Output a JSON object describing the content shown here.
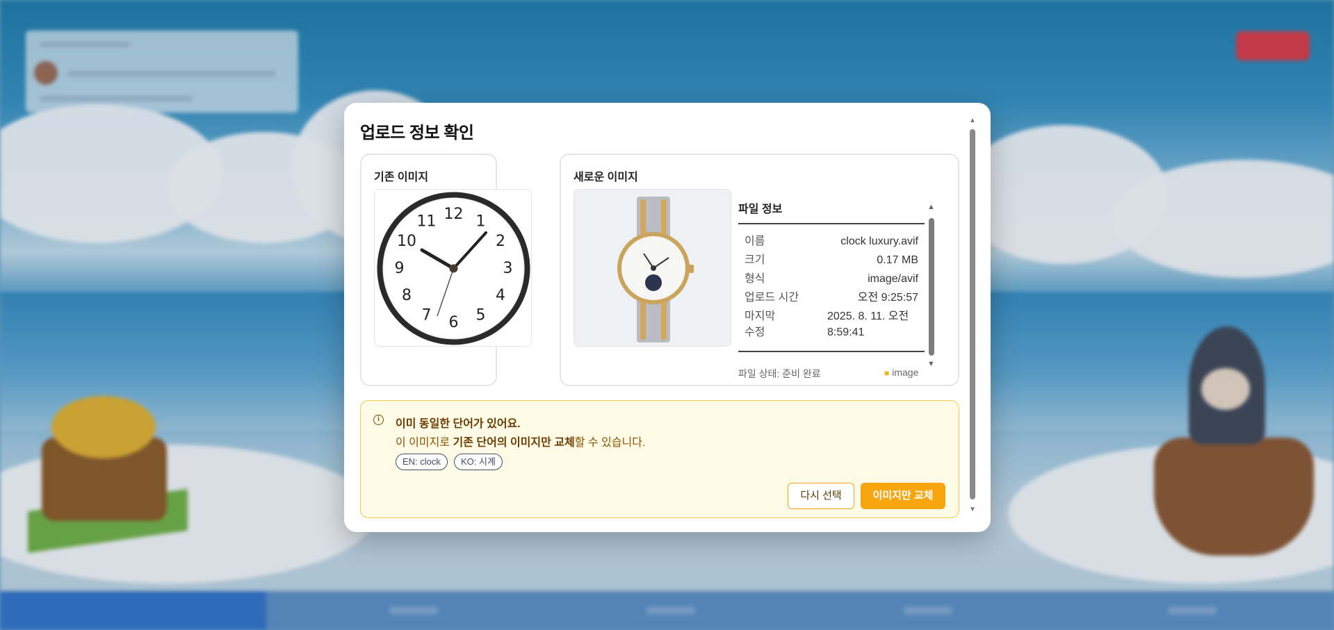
{
  "modal": {
    "title": "업로드 정보 확인",
    "old_image": {
      "title": "기존 이미지",
      "numbers": [
        "12",
        "1",
        "2",
        "3",
        "4",
        "5",
        "6",
        "7",
        "8",
        "9",
        "10",
        "11"
      ]
    },
    "new_image": {
      "title": "새로운 이미지"
    },
    "file_info": {
      "title": "파일 정보",
      "rows": [
        {
          "key": "이름",
          "value": "clock luxury.avif"
        },
        {
          "key": "크기",
          "value": "0.17 MB"
        },
        {
          "key": "형식",
          "value": "image/avif"
        },
        {
          "key": "업로드 시간",
          "value": "오전 9:25:57"
        },
        {
          "key": "마지막 수정",
          "value": "2025. 8. 11. 오전 8:59:41"
        }
      ],
      "status": "파일 상태: 준비 완료",
      "folder": "image"
    },
    "alert": {
      "icon": "info-icon",
      "title": "이미 동일한 단어가 있어요.",
      "desc_prefix": "이 이미지로 ",
      "desc_bold": "기존 단어의 이미지만 교체",
      "desc_suffix": "할 수 있습니다.",
      "chips": [
        "EN: clock",
        "KO: 시계"
      ]
    },
    "buttons": {
      "reselect": "다시 선택",
      "replace": "이미지만 교체"
    }
  },
  "colors": {
    "accent": "#f7a60f",
    "alert_bg": "#fffbe6",
    "alert_border": "#f2c94c"
  }
}
